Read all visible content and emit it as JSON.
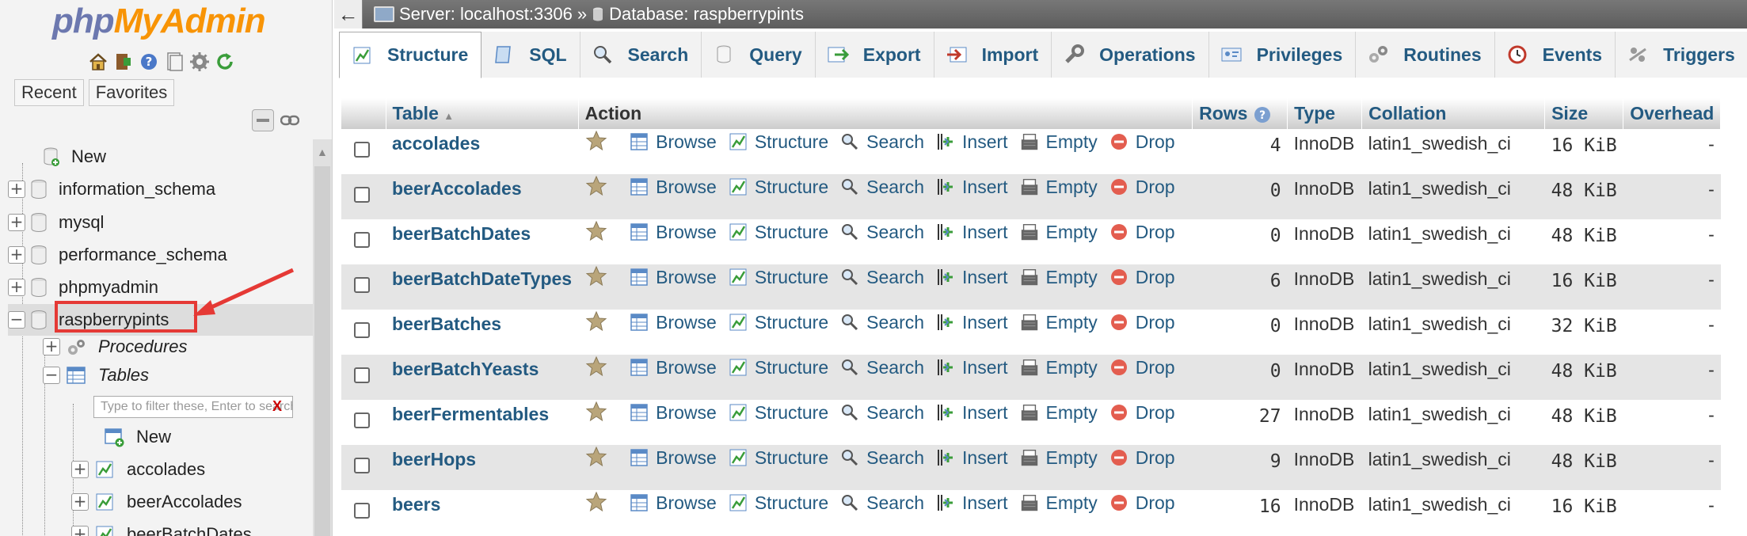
{
  "logo": {
    "php": "php",
    "myadmin": "MyAdmin"
  },
  "nav": {
    "recent": "Recent",
    "favorites": "Favorites",
    "icons": [
      "home-icon",
      "logout-icon",
      "help-icon",
      "docs-icon",
      "settings-icon",
      "reload-icon"
    ],
    "tree": {
      "new": "New",
      "dbs": [
        "information_schema",
        "mysql",
        "performance_schema",
        "phpmyadmin",
        "raspberrypints"
      ],
      "procedures": "Procedures",
      "tables": "Tables",
      "filter_placeholder": "Type to filter these, Enter to search all",
      "filter_clear": "X",
      "table_new": "New",
      "tables_list": [
        "accolades",
        "beerAccolades",
        "beerBatchDates"
      ]
    }
  },
  "breadcrumb": {
    "server": "Server: localhost:3306",
    "sep": "»",
    "database": "Database: raspberrypints"
  },
  "tabs": [
    "Structure",
    "SQL",
    "Search",
    "Query",
    "Export",
    "Import",
    "Operations",
    "Privileges",
    "Routines",
    "Events",
    "Triggers"
  ],
  "table": {
    "headers": {
      "table": "Table",
      "action": "Action",
      "rows": "Rows",
      "type": "Type",
      "collation": "Collation",
      "size": "Size",
      "overhead": "Overhead"
    },
    "actions": {
      "browse": "Browse",
      "structure": "Structure",
      "search": "Search",
      "insert": "Insert",
      "empty": "Empty",
      "drop": "Drop"
    },
    "rows": [
      {
        "name": "accolades",
        "rows": "4",
        "type": "InnoDB",
        "collation": "latin1_swedish_ci",
        "size": "16 KiB",
        "overhead": "-"
      },
      {
        "name": "beerAccolades",
        "rows": "0",
        "type": "InnoDB",
        "collation": "latin1_swedish_ci",
        "size": "48 KiB",
        "overhead": "-"
      },
      {
        "name": "beerBatchDates",
        "rows": "0",
        "type": "InnoDB",
        "collation": "latin1_swedish_ci",
        "size": "48 KiB",
        "overhead": "-"
      },
      {
        "name": "beerBatchDateTypes",
        "rows": "6",
        "type": "InnoDB",
        "collation": "latin1_swedish_ci",
        "size": "16 KiB",
        "overhead": "-"
      },
      {
        "name": "beerBatches",
        "rows": "0",
        "type": "InnoDB",
        "collation": "latin1_swedish_ci",
        "size": "32 KiB",
        "overhead": "-"
      },
      {
        "name": "beerBatchYeasts",
        "rows": "0",
        "type": "InnoDB",
        "collation": "latin1_swedish_ci",
        "size": "48 KiB",
        "overhead": "-"
      },
      {
        "name": "beerFermentables",
        "rows": "27",
        "type": "InnoDB",
        "collation": "latin1_swedish_ci",
        "size": "48 KiB",
        "overhead": "-"
      },
      {
        "name": "beerHops",
        "rows": "9",
        "type": "InnoDB",
        "collation": "latin1_swedish_ci",
        "size": "48 KiB",
        "overhead": "-"
      },
      {
        "name": "beers",
        "rows": "16",
        "type": "InnoDB",
        "collation": "latin1_swedish_ci",
        "size": "16 KiB",
        "overhead": "-"
      }
    ]
  },
  "colors": {
    "link": "#235a81",
    "highlight": "#e53935",
    "logo_php": "#6c78af",
    "logo_myadmin": "#f89406"
  }
}
